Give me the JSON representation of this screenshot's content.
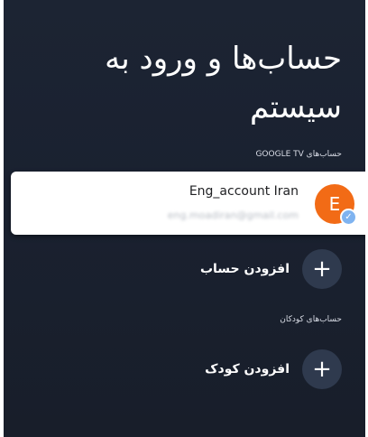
{
  "page": {
    "title": "حساب‌ها و ورود به سیستم"
  },
  "google_tv_section": {
    "label": "حساب‌های GOOGLE TV"
  },
  "account": {
    "avatar_letter": "E",
    "name": "Eng_account Iran",
    "email": "eng.moadiran@gmail.com",
    "avatar_color": "#f26b16"
  },
  "add_account": {
    "label": "افزودن حساب",
    "icon": "plus-icon",
    "icon_glyph": "+"
  },
  "kids_section": {
    "label": "حساب‌های کودکان"
  },
  "add_kid": {
    "label": "افزودن کودک",
    "icon": "plus-icon",
    "icon_glyph": "+"
  }
}
